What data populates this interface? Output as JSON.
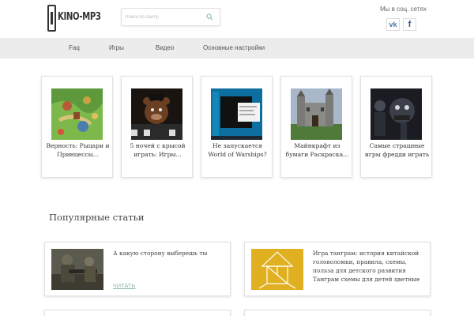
{
  "header": {
    "logo_text": "KINO-MP3",
    "search_placeholder": "Поиск по сайту...",
    "social_label": "Мы в соц. сетях",
    "social_vk": "vk",
    "social_fb": "f"
  },
  "nav": {
    "items": [
      "Faq",
      "Игры",
      "Видео",
      "Основные настройки"
    ]
  },
  "cards": [
    {
      "title": "Верность: Рыцари и Принцессы...",
      "image": "fantasy-map-game"
    },
    {
      "title": "5 ночей с крысой играть: Игры...",
      "image": "animatronic-bear"
    },
    {
      "title": "Не запускается World of Warships?",
      "image": "desktop-screenshot"
    },
    {
      "title": "Майнкрафт из бумаги Раскраска...",
      "image": "minecraft-castle"
    },
    {
      "title": "Самые страшные игры фредди играть",
      "image": "dark-animatronic"
    }
  ],
  "popular": {
    "title": "Популярные статьи",
    "articles": [
      {
        "title": "А какую сторону выберешь ты",
        "read_label": "ЧИТАТЬ",
        "image": "soldier-game"
      },
      {
        "title": "Игра танграм: история китайской головоломки, правила, схемы, польза для детского развития Танграм схемы для детей цветные",
        "image": "tangram"
      }
    ]
  },
  "colors": {
    "nav_bg": "#ececec",
    "read_link": "#8ab4a4",
    "vk": "#4a76a8",
    "fb": "#3b5998"
  }
}
